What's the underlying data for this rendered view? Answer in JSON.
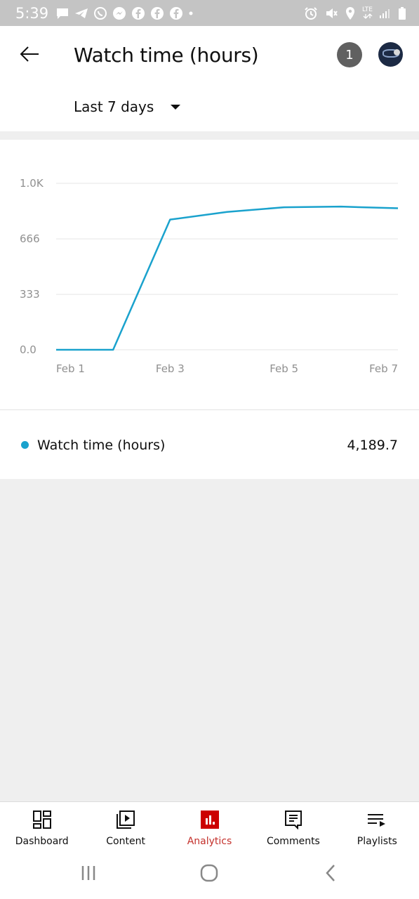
{
  "status_bar": {
    "time": "5:39",
    "network_label": "LTE",
    "left_icons": [
      "chat-bubble-icon",
      "telegram-icon",
      "whatsapp-icon",
      "messenger-icon",
      "facebook-icon",
      "facebook-icon",
      "facebook-icon",
      "dot-icon"
    ],
    "right_icons": [
      "alarm-icon",
      "mute-icon",
      "location-icon",
      "lte-icon",
      "signal-icon",
      "battery-icon"
    ]
  },
  "header": {
    "title": "Watch time (hours)",
    "notification_count": "1",
    "period": "Last 7 days"
  },
  "chart_data": {
    "type": "line",
    "series": [
      {
        "name": "Watch time (hours)",
        "color": "#1aa2cd",
        "x": [
          "Feb 1",
          "Feb 2",
          "Feb 3",
          "Feb 4",
          "Feb 5",
          "Feb 6",
          "Feb 7"
        ],
        "values": [
          0,
          0,
          782,
          828,
          856,
          860,
          850
        ]
      }
    ],
    "y_tick_labels": [
      "1.0K",
      "666",
      "333",
      "0.0"
    ],
    "y_ticks": [
      1000,
      666,
      333,
      0
    ],
    "x_tick_labels": [
      "Feb 1",
      "Feb 3",
      "Feb 5",
      "Feb 7"
    ],
    "ylim": [
      0,
      1000
    ],
    "grid": true
  },
  "legend": {
    "label": "Watch time (hours)",
    "total": "4,189.7",
    "color": "#1aa2cd"
  },
  "bottom_nav": {
    "items": [
      {
        "label": "Dashboard",
        "icon": "dashboard-icon"
      },
      {
        "label": "Content",
        "icon": "content-icon"
      },
      {
        "label": "Analytics",
        "icon": "analytics-icon",
        "active": true
      },
      {
        "label": "Comments",
        "icon": "comments-icon"
      },
      {
        "label": "Playlists",
        "icon": "playlists-icon"
      }
    ],
    "active_color": "#c4302b"
  },
  "system_nav": [
    "recent-apps-icon",
    "home-icon",
    "back-icon"
  ]
}
